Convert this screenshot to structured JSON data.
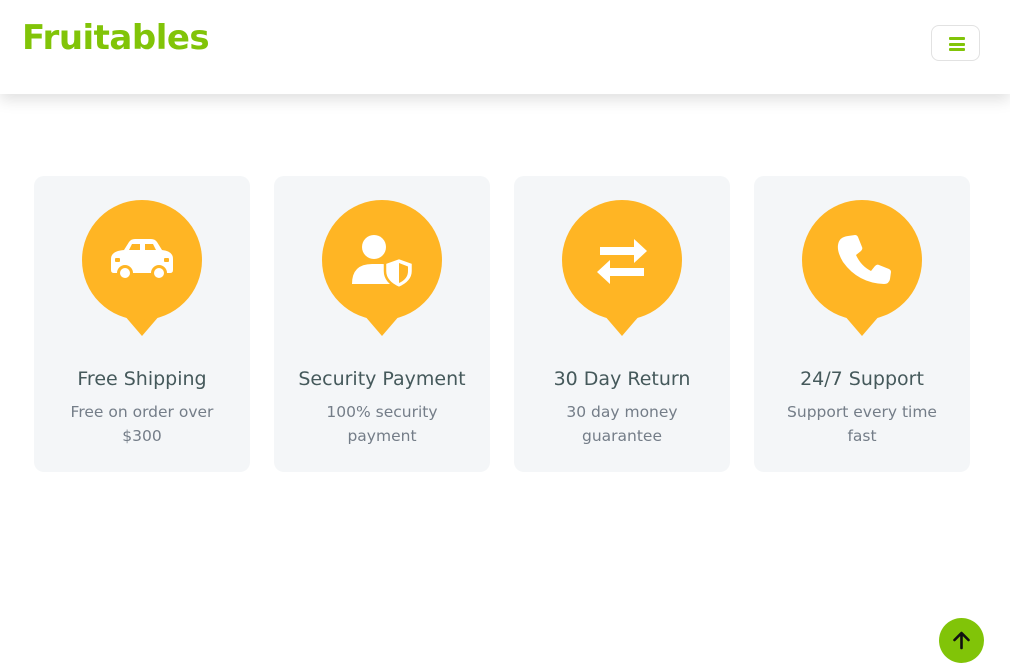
{
  "brand": {
    "name": "Fruitables",
    "color": "#81c408"
  },
  "navbar": {
    "toggler_icon": "bars-icon"
  },
  "features": [
    {
      "icon": "car-icon",
      "title": "Free Shipping",
      "description": "Free on order over $300"
    },
    {
      "icon": "user-shield-icon",
      "title": "Security Payment",
      "description": "100% security payment"
    },
    {
      "icon": "exchange-arrows-icon",
      "title": "30 Day Return",
      "description": "30 day money guarantee"
    },
    {
      "icon": "phone-icon",
      "title": "24/7 Support",
      "description": "Support every time fast"
    }
  ],
  "colors": {
    "accent": "#81c408",
    "icon_badge": "#ffb524",
    "card_bg": "#f4f6f8",
    "title_text": "#45595b",
    "body_text": "#747d88"
  },
  "back_to_top": {
    "icon": "arrow-up-icon"
  }
}
